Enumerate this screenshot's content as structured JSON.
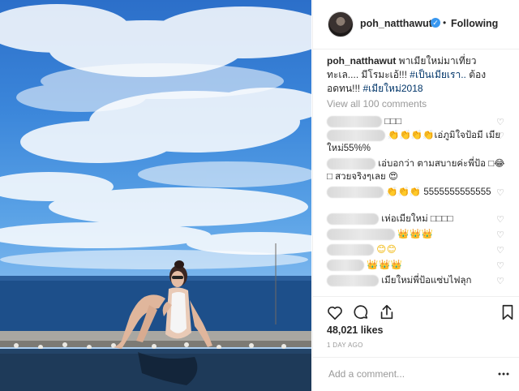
{
  "header": {
    "username": "poh_natthawut",
    "verified_mark": "✓",
    "separator": "•",
    "follow_status": "Following"
  },
  "caption": {
    "username": "poh_natthawut",
    "text": " พาเมียใหม่มาเที่ยวทะเล.... มีโรมะเอ้!!! ",
    "tag1": "#เป็นเมียเรา..",
    "text2": " ต้องอดทน!!! ",
    "tag2": "#เมียใหม่2018"
  },
  "view_all": "View all 100 comments",
  "comments": [
    {
      "text": "□□□"
    },
    {
      "text": "👏👏👏👏เอ่ภูมิใจป้อมี เมียใหม่55%%"
    },
    {
      "text": "เอ่บอกว่า ตามสบายค่ะพี่ป้อ □😂 □ สวยจริงๆเลย 😍"
    },
    {
      "text": "👏👏👏 5555555555555"
    },
    {
      "text": "เห่อเมียใหม่ □□□□"
    },
    {
      "text": "👑👑👑"
    },
    {
      "text": "😊😊"
    },
    {
      "text": "👑👑👑"
    },
    {
      "text": "เมียใหม่พี่ป้อแซ่บไฟลุก"
    }
  ],
  "likes": "48,021 likes",
  "timestamp": "1 DAY AGO",
  "add_comment": {
    "placeholder": "Add a comment..."
  },
  "icons": {
    "like": "heart-icon",
    "comment": "comment-icon",
    "share": "share-icon",
    "save": "bookmark-icon",
    "more": "more-options-icon",
    "comment_like": "heart-small-icon"
  },
  "colors": {
    "verified": "#3897f0",
    "hashtag": "#003569",
    "muted": "#999999"
  }
}
